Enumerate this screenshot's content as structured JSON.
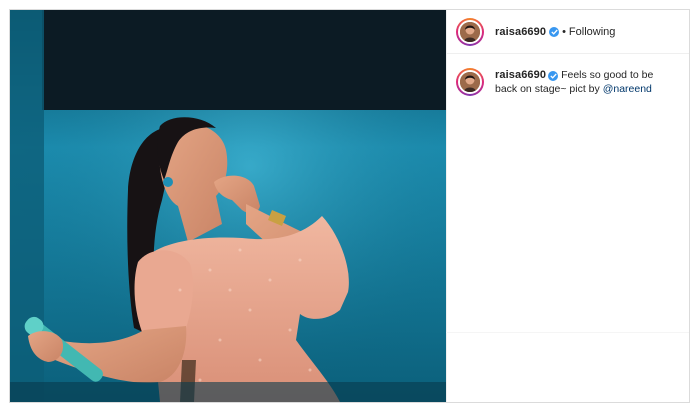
{
  "post": {
    "username": "raisa6690",
    "follow_status": "Following",
    "separator": "•",
    "caption_text": "Feels so good to be back on stage~ pict by",
    "caption_mention": "@nareend"
  },
  "colors": {
    "verified_badge": "#3897f0",
    "mention": "#00376b",
    "photo_background": "#0d6f8c",
    "dress": "#e8a58d"
  },
  "icons": {
    "verified": "verified-badge-icon",
    "avatar": "profile-avatar"
  }
}
